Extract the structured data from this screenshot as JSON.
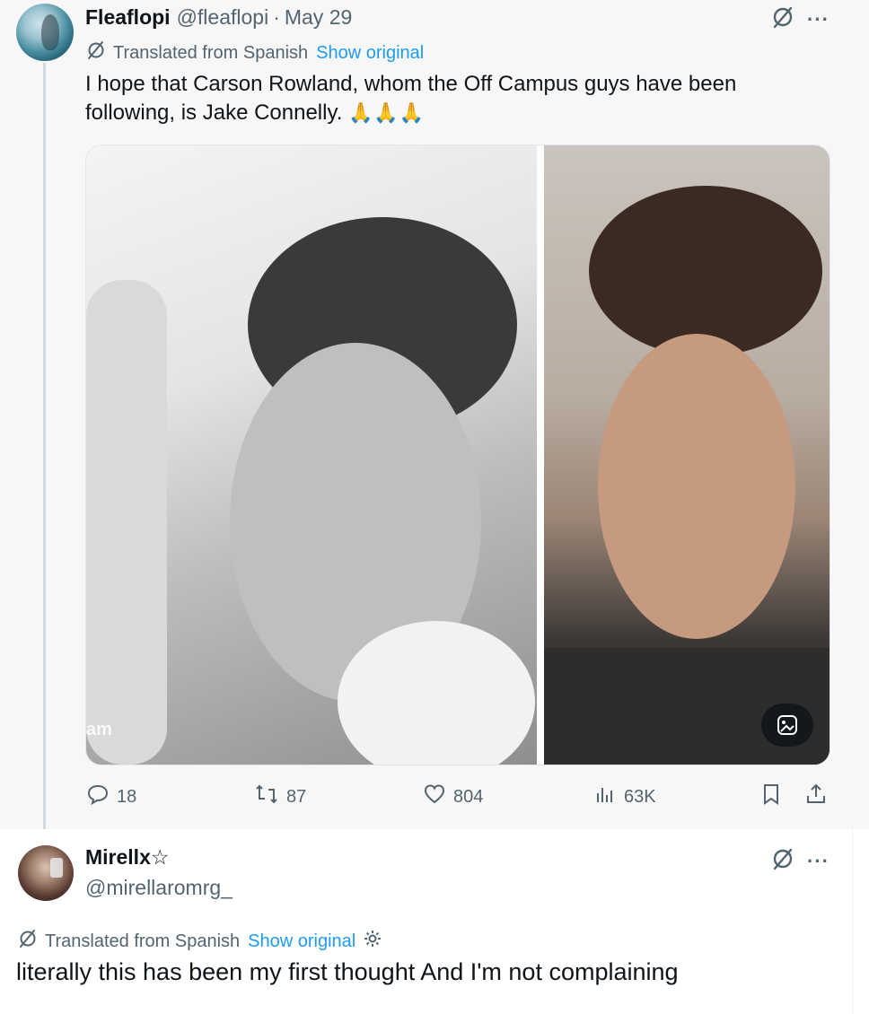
{
  "post": {
    "author_name": "Fleaflopi",
    "handle": "@fleaflopi",
    "separator": "·",
    "date": "May 29",
    "translated_label": "Translated from Spanish",
    "show_original": "Show original",
    "text": "I hope that Carson Rowland, whom the Off Campus guys have been following, is Jake Connelly.",
    "emoji": "🙏🙏🙏",
    "media": {
      "watermark": "am",
      "left_photo_icon": "photo-bw-portrait",
      "right_photo_icon": "photo-color-portrait",
      "button_icon": "image-edit-icon"
    },
    "actions": {
      "replies": "18",
      "reposts": "87",
      "likes": "804",
      "views": "63K"
    }
  },
  "reply": {
    "author_name": "Mirellx☆",
    "handle": "@mirellaromrg_",
    "translated_label": "Translated from Spanish",
    "show_original": "Show original",
    "text": "literally this has been my first thought And I'm not complaining"
  },
  "colors": {
    "text": "#0f1419",
    "muted": "#536471",
    "link": "#1d9bf0",
    "thread_line": "#cfd9de"
  },
  "icons": [
    "grok-icon",
    "more-icon",
    "translate-icon",
    "reply-icon",
    "repost-icon",
    "like-icon",
    "views-icon",
    "bookmark-icon",
    "share-icon",
    "settings-icon"
  ]
}
